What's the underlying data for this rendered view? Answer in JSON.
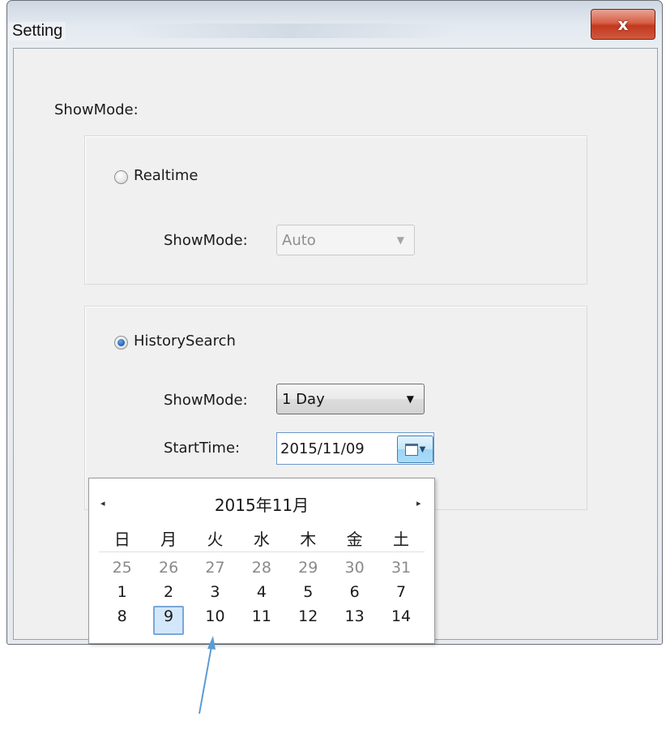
{
  "window": {
    "title": "Setting",
    "close_glyph": "x"
  },
  "main": {
    "show_mode_label": "ShowMode:"
  },
  "realtime": {
    "radio_label": "Realtime",
    "selected": false,
    "show_mode_label": "ShowMode:",
    "show_mode_value": "Auto"
  },
  "history": {
    "radio_label": "HistorySearch",
    "selected": true,
    "show_mode_label": "ShowMode:",
    "show_mode_value": "1 Day",
    "start_time_label": "StartTime:",
    "start_time_value": "2015/11/09"
  },
  "calendar": {
    "month_title": "2015年11月",
    "prev_glyph": "◂",
    "next_glyph": "▸",
    "weekdays": [
      "日",
      "月",
      "火",
      "水",
      "木",
      "金",
      "土"
    ],
    "weeks": [
      [
        "25",
        "26",
        "27",
        "28",
        "29",
        "30",
        "31"
      ],
      [
        "1",
        "2",
        "3",
        "4",
        "5",
        "6",
        "7"
      ],
      [
        "8",
        "9",
        "10",
        "11",
        "12",
        "13",
        "14"
      ]
    ],
    "selected_day": "9"
  },
  "colors": {
    "accent": "#5b9bd5",
    "selection_fill": "#d3e7fb",
    "close_button": "#c2381e"
  }
}
